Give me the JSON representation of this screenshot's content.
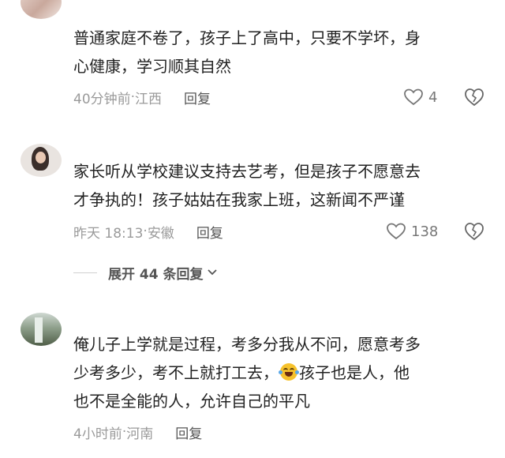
{
  "comments": [
    {
      "content_lines": [
        "普通家庭不卷了，孩子上了高中，只要不学坏，身",
        "心健康，学习顺其自然"
      ],
      "time": "40分钟前",
      "location": "江西",
      "reply_label": "回复",
      "likes": "4"
    },
    {
      "content_lines": [
        "家长听从学校建议支持去艺考，但是孩子不愿意去",
        "才争执的！孩子姑姑在我家上班，这新闻不严谨"
      ],
      "time": "昨天 18:13",
      "location": "安徽",
      "reply_label": "回复",
      "likes": "138",
      "expand_label": "展开 44 条回复"
    },
    {
      "content_lines": [
        "俺儿子上学就是过程，考多分我从不问，愿意考多",
        "少考多少，考不上就打工去，",
        "孩子也是人，他",
        "也不是全能的人，允许自己的平凡"
      ],
      "time": "4小时前",
      "location": "河南",
      "reply_label": "回复"
    }
  ],
  "colors": {
    "meta_text": "#9a9a9a",
    "reply_text": "#555555",
    "content_text": "#222222"
  },
  "icons": [
    "heart-icon",
    "dislike-heart-icon",
    "chevron-down-icon",
    "laughing-crying-emoji"
  ]
}
